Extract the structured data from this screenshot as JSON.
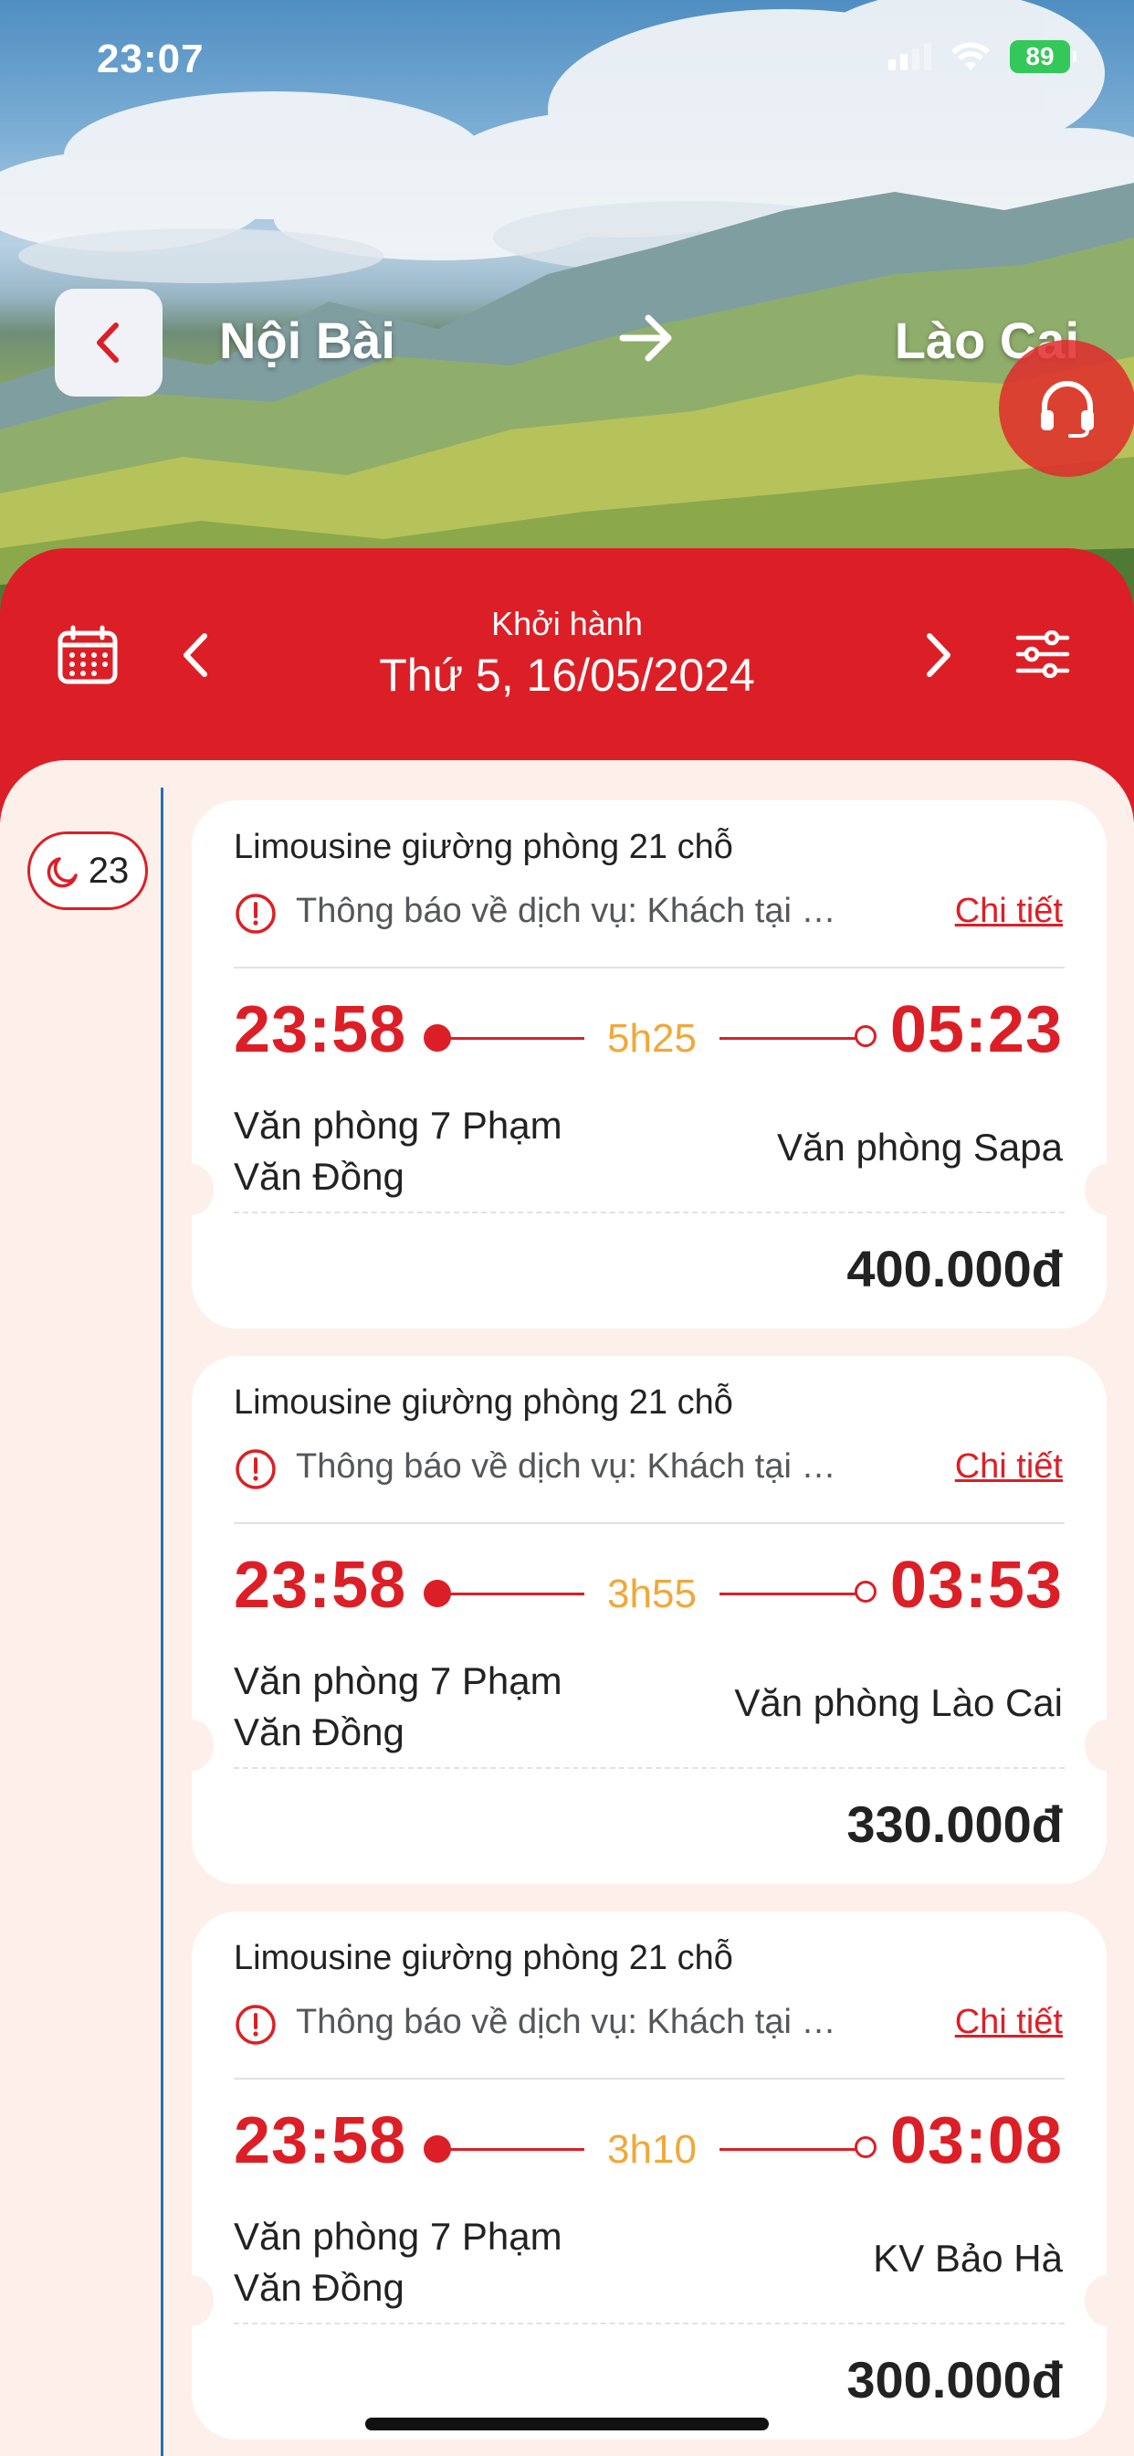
{
  "status_bar": {
    "time": "23:07",
    "battery": "89"
  },
  "header": {
    "from": "Nội Bài",
    "to": "Lào Cai",
    "icons": {
      "back": "chevron-left-icon",
      "arrow": "arrow-right-icon",
      "support": "headset-icon"
    }
  },
  "date_bar": {
    "label": "Khởi hành",
    "date": "Thứ 5, 16/05/2024",
    "icons": {
      "calendar": "calendar-icon",
      "prev": "chevron-left-icon",
      "next": "chevron-right-icon",
      "filter": "sliders-icon"
    }
  },
  "timeline": {
    "hour": "23",
    "icon": "moon-icon"
  },
  "trips": [
    {
      "bus_type": "Limousine giường phòng 21 chỗ",
      "notice": "Thông báo về dịch vụ: Khách tại sân bay Nội Bài",
      "detail_link": "Chi tiết",
      "depart": "23:58",
      "duration": "5h25",
      "arrive": "05:23",
      "from_office": "Văn phòng 7 Phạm Văn Đồng",
      "to_office": "Văn phòng Sapa",
      "price": "400.000đ"
    },
    {
      "bus_type": "Limousine giường phòng 21 chỗ",
      "notice": "Thông báo về dịch vụ: Khách tại sân bay Nội Bài",
      "detail_link": "Chi tiết",
      "depart": "23:58",
      "duration": "3h55",
      "arrive": "03:53",
      "from_office": "Văn phòng 7 Phạm Văn Đồng",
      "to_office": "Văn phòng Lào Cai",
      "price": "330.000đ"
    },
    {
      "bus_type": "Limousine giường phòng 21 chỗ",
      "notice": "Thông báo về dịch vụ: Khách tại sân bay Nội Bài",
      "detail_link": "Chi tiết",
      "depart": "23:58",
      "duration": "3h10",
      "arrive": "03:08",
      "from_office": "Văn phòng 7 Phạm Văn Đồng",
      "to_office": "KV Bảo Hà",
      "price": "300.000đ"
    }
  ],
  "colors": {
    "primary_red": "#dc1f26",
    "duration_orange": "#f0a838",
    "timeline_blue": "#2a6fb3"
  }
}
